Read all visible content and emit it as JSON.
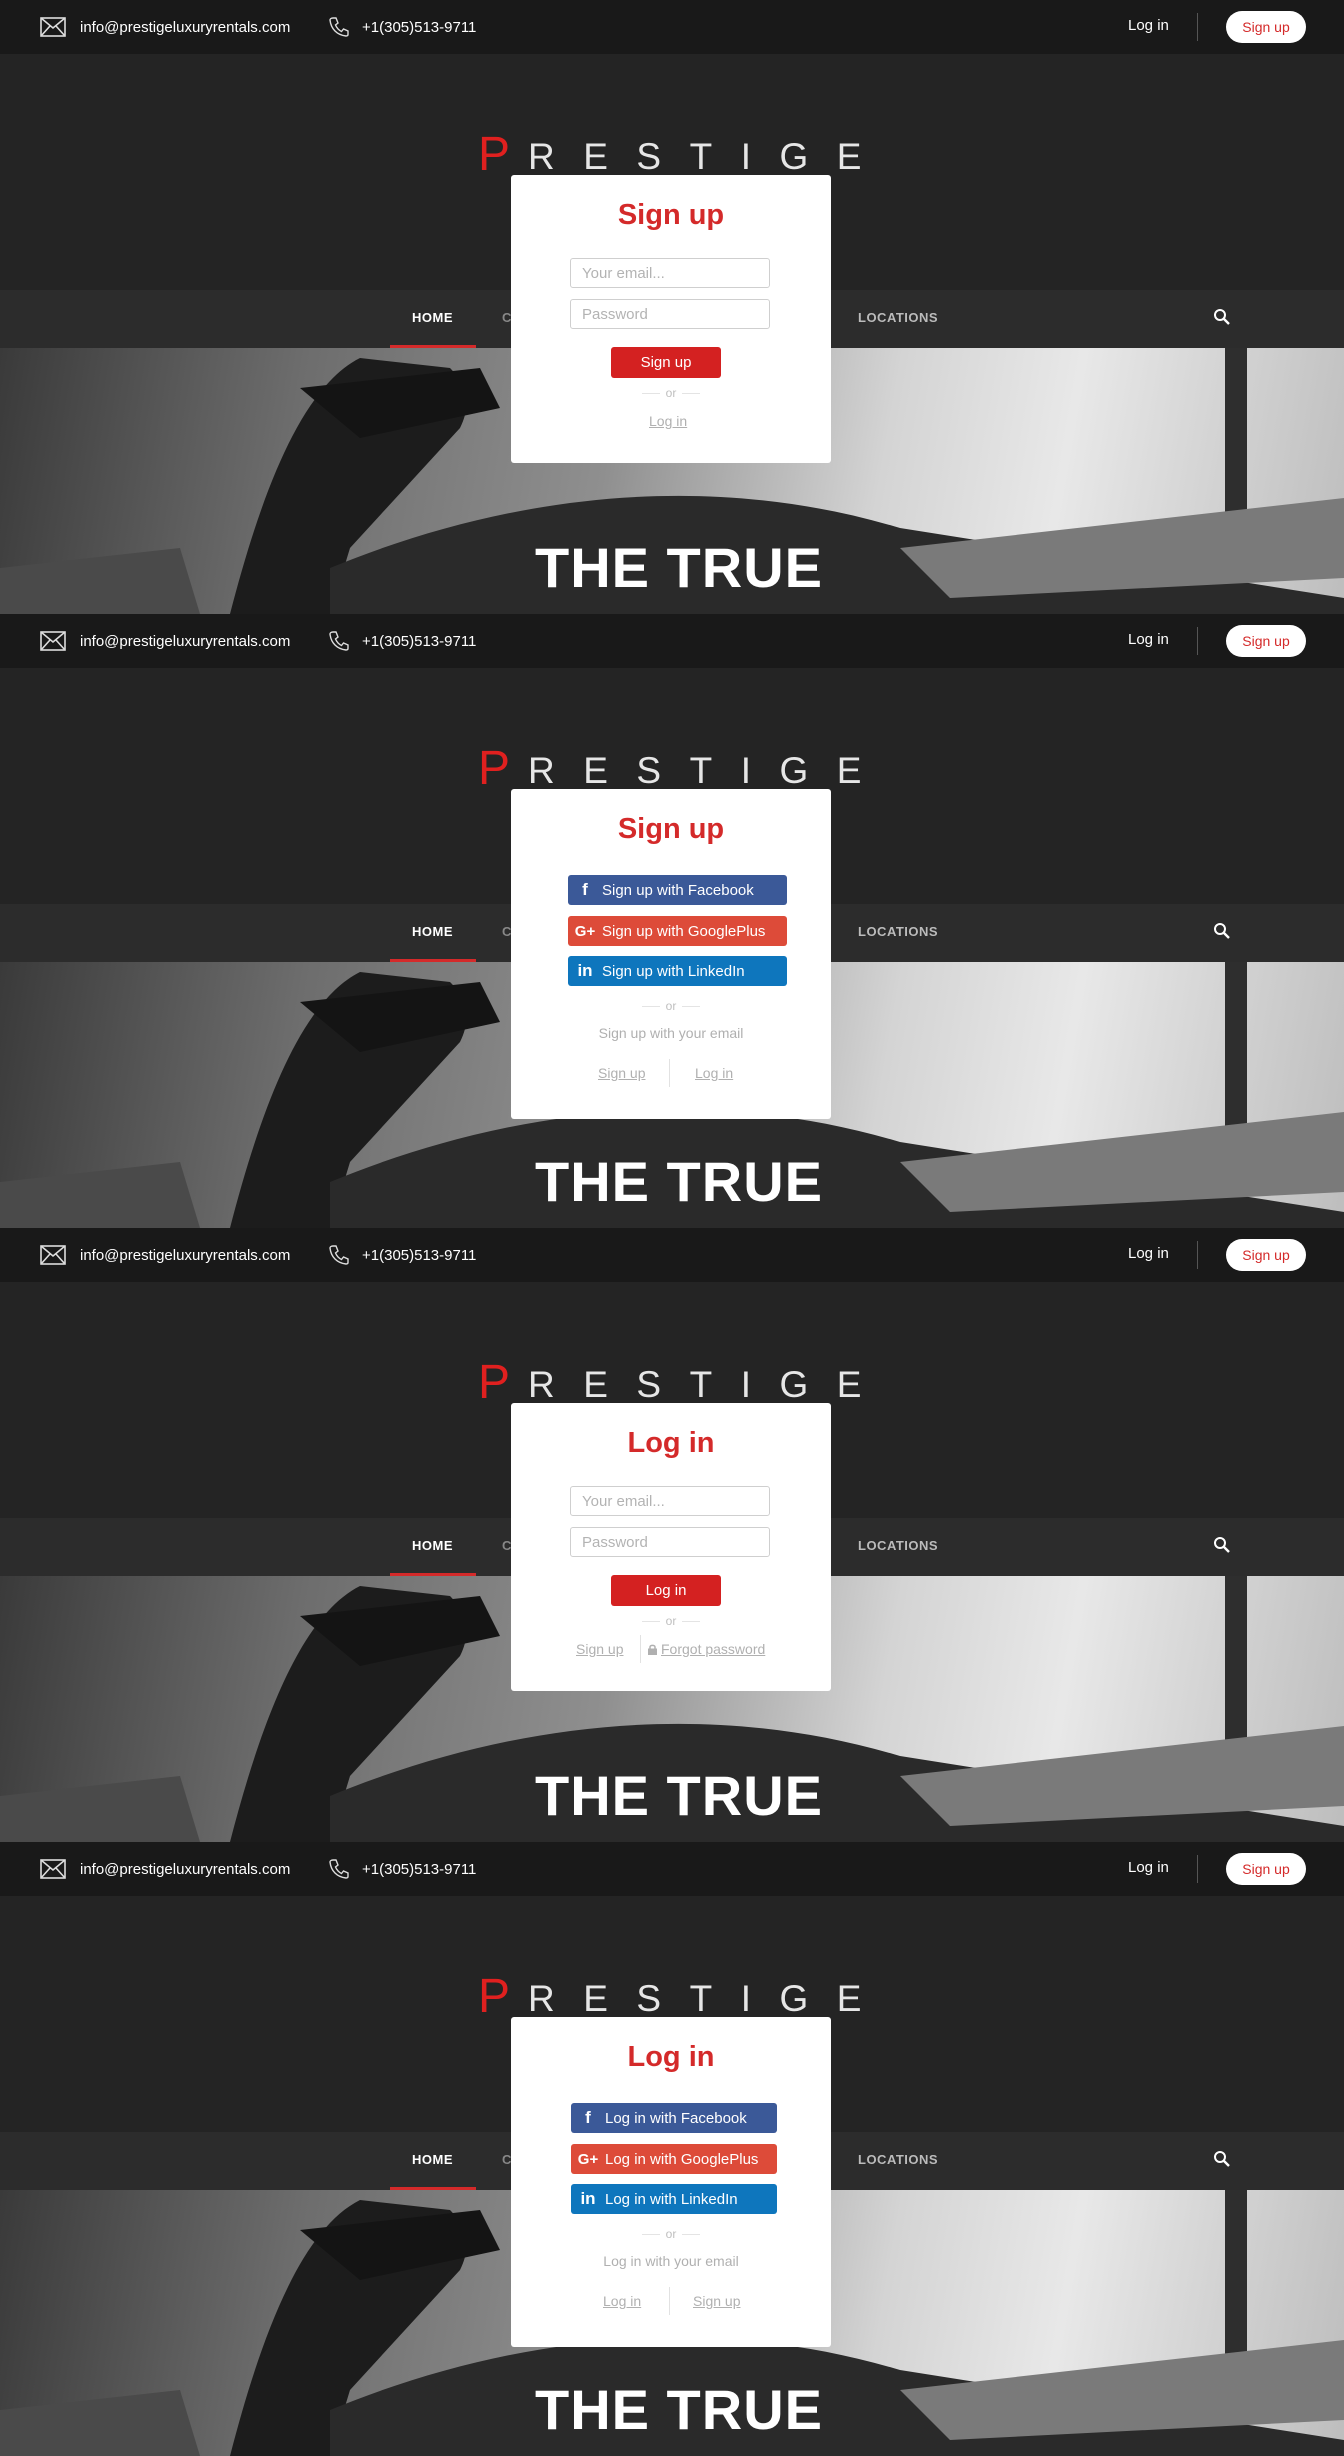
{
  "topbar": {
    "email": "info@prestigeluxuryrentals.com",
    "phone": "+1(305)513-9711",
    "login": "Log in",
    "signup": "Sign up"
  },
  "logo": {
    "first": "P",
    "rest": "RESTIGE"
  },
  "nav": {
    "home": "HOME",
    "partial": "C",
    "locations": "LOCATIONS"
  },
  "hero": {
    "headline": "THE TRUE"
  },
  "modals": {
    "signup_email": {
      "title": "Sign up",
      "email_placeholder": "Your email...",
      "password_placeholder": "Password",
      "submit": "Sign up",
      "or": "or",
      "login_link": "Log in"
    },
    "signup_social": {
      "title": "Sign up",
      "facebook": "Sign up with Facebook",
      "google": "Sign up with GooglePlus",
      "linkedin": "Sign up with LinkedIn",
      "or": "or",
      "email_text": "Sign up with your email",
      "signup_link": "Sign up",
      "login_link": "Log in"
    },
    "login_email": {
      "title": "Log in",
      "email_placeholder": "Your email...",
      "password_placeholder": "Password",
      "submit": "Log in",
      "or": "or",
      "signup_link": "Sign up",
      "forgot_link": "Forgot password"
    },
    "login_social": {
      "title": "Log in",
      "facebook": "Log in with Facebook",
      "google": "Log in with GooglePlus",
      "linkedin": "Log in with LinkedIn",
      "or": "or",
      "email_text": "Log in with your email",
      "login_link": "Log in",
      "signup_link": "Sign up"
    }
  },
  "icons": {
    "email": "envelope-icon",
    "phone": "phone-icon",
    "search": "search-icon",
    "facebook": "facebook-icon",
    "google": "googleplus-icon",
    "linkedin": "linkedin-icon",
    "lock": "lock-icon"
  },
  "colors": {
    "brand_red": "#d42a2a",
    "facebook": "#3b5998",
    "google": "#dd4b39",
    "linkedin": "#0e76bd",
    "topbar": "#191919"
  }
}
